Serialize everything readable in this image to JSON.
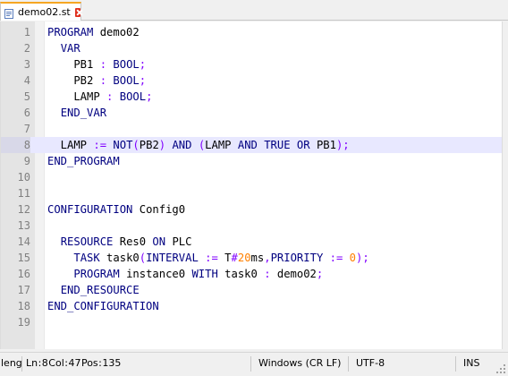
{
  "tab": {
    "filename": "demo02.st",
    "icon": "file-icon",
    "close_icon": "close-icon"
  },
  "editor": {
    "lines": [
      {
        "n": "1",
        "tokens": [
          {
            "c": "kw",
            "t": "PROGRAM"
          },
          {
            "c": "",
            "t": " demo02"
          }
        ]
      },
      {
        "n": "2",
        "tokens": [
          {
            "c": "",
            "t": "  "
          },
          {
            "c": "kw",
            "t": "VAR"
          }
        ]
      },
      {
        "n": "3",
        "tokens": [
          {
            "c": "",
            "t": "    PB1 "
          },
          {
            "c": "op",
            "t": ":"
          },
          {
            "c": "",
            "t": " "
          },
          {
            "c": "kw",
            "t": "BOOL"
          },
          {
            "c": "op",
            "t": ";"
          }
        ]
      },
      {
        "n": "4",
        "tokens": [
          {
            "c": "",
            "t": "    PB2 "
          },
          {
            "c": "op",
            "t": ":"
          },
          {
            "c": "",
            "t": " "
          },
          {
            "c": "kw",
            "t": "BOOL"
          },
          {
            "c": "op",
            "t": ";"
          }
        ]
      },
      {
        "n": "5",
        "tokens": [
          {
            "c": "",
            "t": "    LAMP "
          },
          {
            "c": "op",
            "t": ":"
          },
          {
            "c": "",
            "t": " "
          },
          {
            "c": "kw",
            "t": "BOOL"
          },
          {
            "c": "op",
            "t": ";"
          }
        ]
      },
      {
        "n": "6",
        "tokens": [
          {
            "c": "",
            "t": "  "
          },
          {
            "c": "kw",
            "t": "END_VAR"
          }
        ]
      },
      {
        "n": "7",
        "tokens": []
      },
      {
        "n": "8",
        "tokens": [
          {
            "c": "",
            "t": "  LAMP "
          },
          {
            "c": "op",
            "t": ":="
          },
          {
            "c": "",
            "t": " "
          },
          {
            "c": "kw",
            "t": "NOT"
          },
          {
            "c": "op",
            "t": "("
          },
          {
            "c": "",
            "t": "PB2"
          },
          {
            "c": "op",
            "t": ")"
          },
          {
            "c": "",
            "t": " "
          },
          {
            "c": "kw",
            "t": "AND"
          },
          {
            "c": "",
            "t": " "
          },
          {
            "c": "op",
            "t": "("
          },
          {
            "c": "",
            "t": "LAMP "
          },
          {
            "c": "kw",
            "t": "AND"
          },
          {
            "c": "",
            "t": " "
          },
          {
            "c": "kw",
            "t": "TRUE"
          },
          {
            "c": "",
            "t": " "
          },
          {
            "c": "kw",
            "t": "OR"
          },
          {
            "c": "",
            "t": " PB1"
          },
          {
            "c": "op",
            "t": ");"
          }
        ]
      },
      {
        "n": "9",
        "tokens": [
          {
            "c": "kw",
            "t": "END_PROGRAM"
          }
        ]
      },
      {
        "n": "10",
        "tokens": []
      },
      {
        "n": "11",
        "tokens": []
      },
      {
        "n": "12",
        "tokens": [
          {
            "c": "kw",
            "t": "CONFIGURATION"
          },
          {
            "c": "",
            "t": " Config0"
          }
        ]
      },
      {
        "n": "13",
        "tokens": []
      },
      {
        "n": "14",
        "tokens": [
          {
            "c": "",
            "t": "  "
          },
          {
            "c": "kw",
            "t": "RESOURCE"
          },
          {
            "c": "",
            "t": " Res0 "
          },
          {
            "c": "kw",
            "t": "ON"
          },
          {
            "c": "",
            "t": " PLC"
          }
        ]
      },
      {
        "n": "15",
        "tokens": [
          {
            "c": "",
            "t": "    "
          },
          {
            "c": "kw",
            "t": "TASK"
          },
          {
            "c": "",
            "t": " task0"
          },
          {
            "c": "op",
            "t": "("
          },
          {
            "c": "kw",
            "t": "INTERVAL"
          },
          {
            "c": "",
            "t": " "
          },
          {
            "c": "op",
            "t": ":="
          },
          {
            "c": "",
            "t": " T"
          },
          {
            "c": "op",
            "t": "#"
          },
          {
            "c": "num",
            "t": "20"
          },
          {
            "c": "",
            "t": "ms"
          },
          {
            "c": "op",
            "t": ","
          },
          {
            "c": "kw",
            "t": "PRIORITY"
          },
          {
            "c": "",
            "t": " "
          },
          {
            "c": "op",
            "t": ":="
          },
          {
            "c": "",
            "t": " "
          },
          {
            "c": "num",
            "t": "0"
          },
          {
            "c": "op",
            "t": ");"
          }
        ]
      },
      {
        "n": "16",
        "tokens": [
          {
            "c": "",
            "t": "    "
          },
          {
            "c": "kw",
            "t": "PROGRAM"
          },
          {
            "c": "",
            "t": " instance0 "
          },
          {
            "c": "kw",
            "t": "WITH"
          },
          {
            "c": "",
            "t": " task0 "
          },
          {
            "c": "op",
            "t": ":"
          },
          {
            "c": "",
            "t": " demo02"
          },
          {
            "c": "op",
            "t": ";"
          }
        ]
      },
      {
        "n": "17",
        "tokens": [
          {
            "c": "",
            "t": "  "
          },
          {
            "c": "kw",
            "t": "END_RESOURCE"
          }
        ]
      },
      {
        "n": "18",
        "tokens": [
          {
            "c": "kw",
            "t": "END_CONFIGURATION"
          }
        ]
      },
      {
        "n": "19",
        "tokens": []
      }
    ],
    "highlighted_line": "8"
  },
  "statusbar": {
    "length": "leng",
    "ln_col_pos": "Ln : 8    Col : 47    Pos : 135",
    "eol": "Windows (CR LF)",
    "encoding": "UTF-8",
    "mode": "INS"
  },
  "colors": {
    "tab_accent": "#f5a623",
    "keyword": "#000080",
    "operator": "#8000ff",
    "number": "#ff8000",
    "current_line": "#e8e8ff"
  }
}
